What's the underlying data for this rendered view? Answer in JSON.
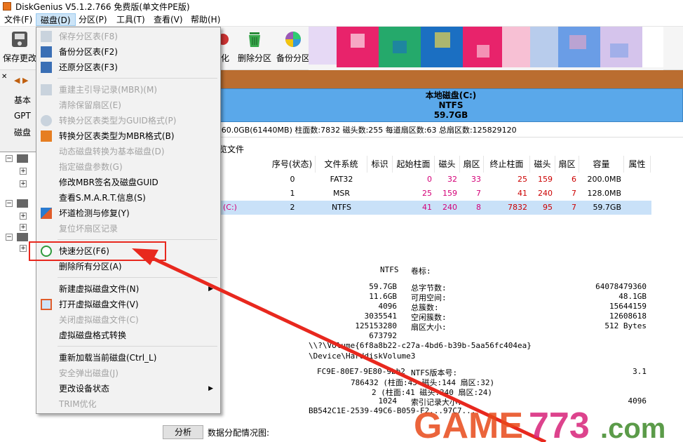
{
  "title": "DiskGenius V5.1.2.766 免费版(单文件PE版)",
  "menubar": [
    "文件(F)",
    "磁盘(D)",
    "分区(P)",
    "工具(T)",
    "查看(V)",
    "帮助(H)"
  ],
  "toolbar": {
    "save_label": "保存更改",
    "partial_label": "化",
    "delete_label": "删除分区",
    "backup_label": "备份分区"
  },
  "left": {
    "a": "基本",
    "b": "GPT",
    "c": "磁盘"
  },
  "banner": {
    "name": "本地磁盘(C:)",
    "fs": "NTFS",
    "size": "59.7GB"
  },
  "diskinfo": ":60.0GB(61440MB)  柱面数:7832  磁头数:255  每道扇区数:63  总扇区数:125829120",
  "tab_label": "览文件",
  "table": {
    "headers": [
      "序号(状态)",
      "文件系统",
      "标识",
      "起始柱面",
      "磁头",
      "扇区",
      "终止柱面",
      "磁头",
      "扇区",
      "容量",
      "属性"
    ],
    "rows": [
      {
        "name": "",
        "num": "0",
        "fs": "FAT32",
        "sc": "0",
        "sh": "32",
        "ss": "33",
        "ec": "25",
        "eh": "159",
        "es": "6",
        "cap": "200.0MB"
      },
      {
        "name": "",
        "num": "1",
        "fs": "MSR",
        "sc": "25",
        "sh": "159",
        "ss": "7",
        "ec": "41",
        "eh": "240",
        "es": "7",
        "cap": "128.0MB"
      },
      {
        "name": "(C:)",
        "num": "2",
        "fs": "NTFS",
        "sc": "41",
        "sh": "240",
        "ss": "8",
        "ec": "7832",
        "eh": "95",
        "es": "7",
        "cap": "59.7GB"
      }
    ]
  },
  "details": {
    "fs_type": "NTFS",
    "vol_label": "卷标:",
    "total": "59.7GB",
    "total_bytes_label": "总字节数:",
    "total_bytes": "64078479360",
    "used": "11.6GB",
    "free_label": "可用空间:",
    "free": "48.1GB",
    "cluster": "4096",
    "total_clusters_label": "总簇数:",
    "total_clusters": "15644159",
    "used_clusters": "3035541",
    "free_clusters_label": "空闲簇数:",
    "free_clusters": "12608618",
    "sectors": "125153280",
    "sector_size_label": "扇区大小:",
    "sector_size": "512 Bytes",
    "start": "673792",
    "guid_path": "\\\\?\\Volume{6f8a8b22-c27a-4bd6-b39b-5aa56fc404ea}",
    "device_path": "\\Device\\HarddiskVolume3",
    "serial": "FC9E-80E7-9E80-9bb2",
    "ntfs_ver_label": "NTFS版本号:",
    "ntfs_ver": "3.1",
    "mft": "786432 (柱面:45 磁头:144 扇区:32)",
    "mft_mirror": "2 (柱面:41 磁头:240 扇区:24)",
    "index_size": "1024",
    "index_label": "索引记录大小:",
    "index_val": "4096",
    "guid": "BB542C1E-2539-49C6-B059-F2...97C7..."
  },
  "bottom": {
    "analyze": "分析",
    "alloc": "数据分配情况图:"
  },
  "menu": {
    "items": [
      "保存分区表(F8)",
      "备份分区表(F2)",
      "还原分区表(F3)",
      "重建主引导记录(MBR)(M)",
      "清除保留扇区(E)",
      "转换分区表类型为GUID格式(P)",
      "转换分区表类型为MBR格式(B)",
      "动态磁盘转换为基本磁盘(D)",
      "指定磁盘参数(G)",
      "修改MBR签名及磁盘GUID",
      "查看S.M.A.R.T.信息(S)",
      "坏道检测与修复(Y)",
      "复位坏扇区记录",
      "快速分区(F6)",
      "删除所有分区(A)",
      "新建虚拟磁盘文件(N)",
      "打开虚拟磁盘文件(V)",
      "关闭虚拟磁盘文件(C)",
      "虚拟磁盘格式转换",
      "重新加载当前磁盘(Ctrl_L)",
      "安全弹出磁盘(J)",
      "更改设备状态",
      "TRIM优化"
    ]
  },
  "watermark": "GAME773.com",
  "colors": {
    "accent": "#5aa8ea",
    "highlight": "#e8281e",
    "banner_top": "#ba6d30"
  }
}
